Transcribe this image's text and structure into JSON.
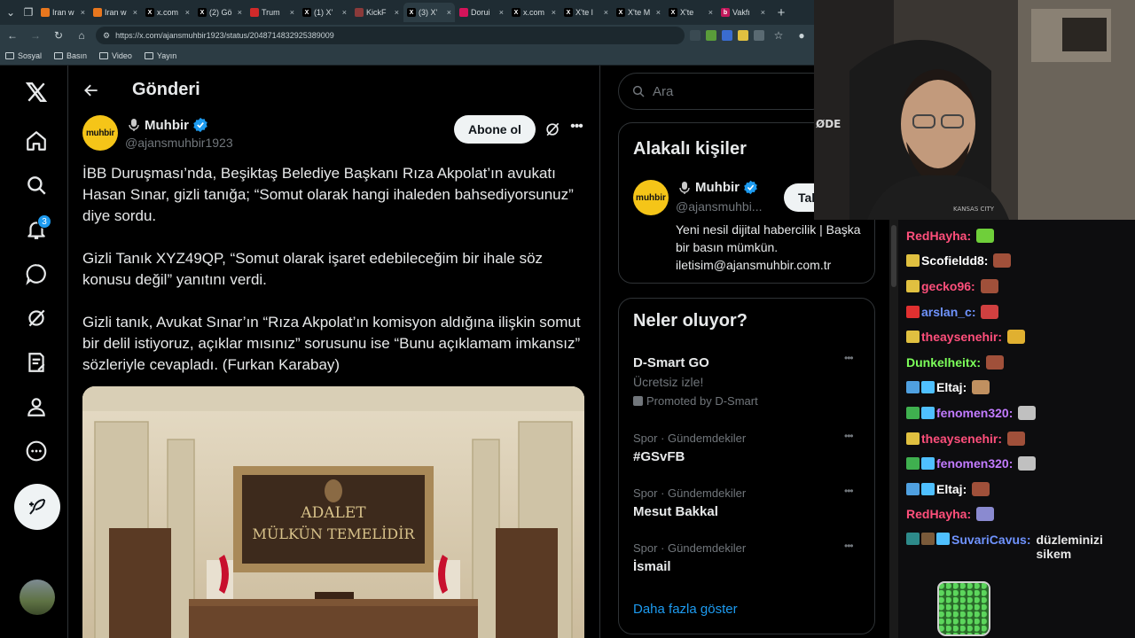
{
  "browser": {
    "tabs": [
      {
        "label": "Iran w",
        "favicon_color": "#e8771e",
        "glyph": ""
      },
      {
        "label": "Iran w",
        "favicon_color": "#e8771e",
        "glyph": ""
      },
      {
        "label": "x.com",
        "favicon_color": "#000000",
        "glyph": "X"
      },
      {
        "label": "(2) Gö",
        "favicon_color": "#000000",
        "glyph": "X"
      },
      {
        "label": "Trum",
        "favicon_color": "#d02a2a",
        "glyph": ""
      },
      {
        "label": "(1) X'",
        "favicon_color": "#000000",
        "glyph": "X"
      },
      {
        "label": "KickF",
        "favicon_color": "#8a3a3a",
        "glyph": ""
      },
      {
        "label": "(3) X'",
        "favicon_color": "#000000",
        "glyph": "X"
      },
      {
        "label": "Dorui",
        "favicon_color": "#d4145a",
        "glyph": ""
      },
      {
        "label": "x.com",
        "favicon_color": "#000000",
        "glyph": "X"
      },
      {
        "label": "X'te l",
        "favicon_color": "#000000",
        "glyph": "X"
      },
      {
        "label": "X'te M",
        "favicon_color": "#000000",
        "glyph": "X"
      },
      {
        "label": "X'te",
        "favicon_color": "#000000",
        "glyph": "X"
      },
      {
        "label": "Vakfı",
        "favicon_color": "#c2185b",
        "glyph": "b"
      }
    ],
    "url": "https://x.com/ajansmuhbir1923/status/2048714832925389009",
    "bookmarks": [
      "Sosyal",
      "Basın",
      "Video",
      "Yayın"
    ]
  },
  "header": {
    "title": "Gönderi"
  },
  "post": {
    "author": {
      "avatar_text": "muhbir",
      "name": "Muhbir",
      "handle": "@ajansmuhbir1923"
    },
    "subscribe_label": "Abone ol",
    "paragraphs": [
      "İBB Duruşması’nda, Beşiktaş Belediye Başkanı Rıza Akpolat’ın avukatı Hasan Sınar, gizli tanığa; “Somut olarak hangi ihaleden bahsediyorsunuz” diye sordu.",
      "Gizli Tanık XYZ49QP, “Somut olarak işaret edebileceğim bir ihale söz konusu değil” yanıtını verdi.",
      "Gizli tanık, Avukat Sınar’ın “Rıza Akpolat’ın komisyon aldığına ilişkin somut bir delil istiyoruz, açıklar mısınız” sorusunu ise “Bunu açıklamam imkansız” sözleriyle cevapladı. (Furkan Karabay)"
    ],
    "image_text": {
      "line1": "ADALET",
      "line2": "MÜLKÜN TEMELİDİR"
    }
  },
  "sidebar": {
    "search_placeholder": "Ara",
    "related": {
      "title": "Alakalı kişiler",
      "name": "Muhbir",
      "handle": "@ajansmuhbi...",
      "follow_label": "Tak",
      "bio": "Yeni nesil dijital habercilik | Başka bir basın mümkün. iletisim@ajansmuhbir.com.tr"
    },
    "trends": {
      "title": "Neler oluyor?",
      "items": [
        {
          "context": "",
          "name": "D-Smart GO",
          "sub": "Ücretsiz izle!",
          "promo": "Promoted by D-Smart"
        },
        {
          "context": "Spor · Gündemdekiler",
          "name": "#GSvFB",
          "sub": "",
          "promo": ""
        },
        {
          "context": "Spor · Gündemdekiler",
          "name": "Mesut Bakkal",
          "sub": "",
          "promo": ""
        },
        {
          "context": "Spor · Gündemdekiler",
          "name": "İsmail",
          "sub": "",
          "promo": ""
        }
      ],
      "show_more": "Daha fazla göster"
    }
  },
  "stream": {
    "webcam_sign": "ØDE",
    "shirt_text": "KANSAS CITY",
    "chat": [
      {
        "user": "RedHayha:",
        "color": "#ff4f7b",
        "badges": [],
        "message": "",
        "emote": "#6fcf3a"
      },
      {
        "user": "Scofieldd8:",
        "color": "#ffffff",
        "badges": [
          "#e0c040"
        ],
        "message": "",
        "emote": "#a0503a"
      },
      {
        "user": "gecko96:",
        "color": "#ff4f7b",
        "badges": [
          "#e0c040"
        ],
        "message": "",
        "emote": "#a0503a"
      },
      {
        "user": "arslan_c:",
        "color": "#6f93ff",
        "badges": [
          "#e03030"
        ],
        "message": "",
        "emote": "#d04040"
      },
      {
        "user": "theaysenehir:",
        "color": "#ff4f7b",
        "badges": [
          "#e0c040"
        ],
        "message": "",
        "emote": "#e0b030"
      },
      {
        "user": "Dunkelheitx:",
        "color": "#7cff5a",
        "badges": [],
        "message": "",
        "emote": "#a0503a"
      },
      {
        "user": "Eltaj:",
        "color": "#ffffff",
        "badges": [
          "#4fa0e0",
          "#4fc0ff"
        ],
        "message": "",
        "emote": "#c09060"
      },
      {
        "user": "fenomen320:",
        "color": "#c27bff",
        "badges": [
          "#3fb04f",
          "#4fc0ff"
        ],
        "message": "",
        "emote": "#c0c0c0"
      },
      {
        "user": "theaysenehir:",
        "color": "#ff4f7b",
        "badges": [
          "#e0c040"
        ],
        "message": "",
        "emote": "#a0503a"
      },
      {
        "user": "fenomen320:",
        "color": "#c27bff",
        "badges": [
          "#3fb04f",
          "#4fc0ff"
        ],
        "message": "",
        "emote": "#c0c0c0"
      },
      {
        "user": "Eltaj:",
        "color": "#ffffff",
        "badges": [
          "#4fa0e0",
          "#4fc0ff"
        ],
        "message": "",
        "emote": "#a0503a"
      },
      {
        "user": "RedHayha:",
        "color": "#ff4f7b",
        "badges": [],
        "message": "",
        "emote": "#8a8ad0"
      },
      {
        "user": "SuvariCavus:",
        "color": "#6f93ff",
        "badges": [
          "#2d8a8a",
          "#7a5a3a",
          "#4fc0ff"
        ],
        "message": "düzleminizi sikem",
        "emote": ""
      }
    ]
  }
}
